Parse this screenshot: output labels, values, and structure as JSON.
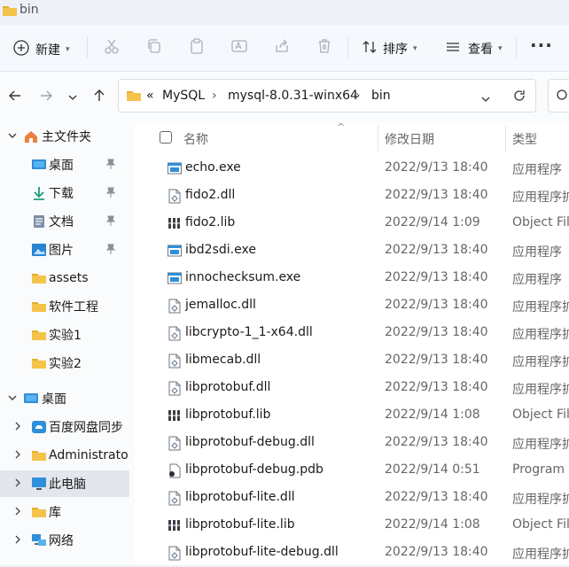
{
  "window": {
    "title": "bin"
  },
  "toolbar": {
    "new_label": "新建",
    "sort_label": "排序",
    "view_label": "查看",
    "more_label": "···"
  },
  "nav": {
    "breadcrumb_prefix": "«",
    "path": [
      "MySQL",
      "mysql-8.0.31-winx64",
      "bin"
    ],
    "separator": "›"
  },
  "sidebar": {
    "items": [
      {
        "label": "主文件夹",
        "icon": "home-icon",
        "expand": "open",
        "pinned": false,
        "selected": false
      },
      {
        "label": "桌面",
        "icon": "desktop-icon",
        "expand": "",
        "pinned": true,
        "selected": false
      },
      {
        "label": "下载",
        "icon": "download-icon",
        "expand": "",
        "pinned": true,
        "selected": false
      },
      {
        "label": "文档",
        "icon": "document-icon",
        "expand": "",
        "pinned": true,
        "selected": false
      },
      {
        "label": "图片",
        "icon": "pictures-icon",
        "expand": "",
        "pinned": true,
        "selected": false
      },
      {
        "label": "assets",
        "icon": "folder-icon",
        "expand": "",
        "pinned": false,
        "selected": false
      },
      {
        "label": "软件工程",
        "icon": "folder-icon",
        "expand": "",
        "pinned": false,
        "selected": false
      },
      {
        "label": "实验1",
        "icon": "folder-icon",
        "expand": "",
        "pinned": false,
        "selected": false
      },
      {
        "label": "实验2",
        "icon": "folder-icon",
        "expand": "",
        "pinned": false,
        "selected": false
      },
      {
        "label": "桌面",
        "icon": "desktop-icon",
        "expand": "open",
        "pinned": false,
        "selected": false
      },
      {
        "label": "百度网盘同步",
        "icon": "cloud-icon",
        "expand": "closed",
        "pinned": false,
        "selected": false
      },
      {
        "label": "Administrato",
        "icon": "folder-icon",
        "expand": "closed",
        "pinned": false,
        "selected": false
      },
      {
        "label": "此电脑",
        "icon": "computer-icon",
        "expand": "closed",
        "pinned": false,
        "selected": true
      },
      {
        "label": "库",
        "icon": "folder-icon",
        "expand": "closed",
        "pinned": false,
        "selected": false
      },
      {
        "label": "网络",
        "icon": "network-icon",
        "expand": "closed",
        "pinned": false,
        "selected": false
      }
    ]
  },
  "columns": {
    "name": "名称",
    "date": "修改日期",
    "type": "类型"
  },
  "files": [
    {
      "name": "echo.exe",
      "date": "2022/9/13 18:40",
      "type": "应用程序",
      "icon": "exe-icon"
    },
    {
      "name": "fido2.dll",
      "date": "2022/9/13 18:40",
      "type": "应用程序扩",
      "icon": "dll-icon"
    },
    {
      "name": "fido2.lib",
      "date": "2022/9/14 1:09",
      "type": "Object File",
      "icon": "lib-icon"
    },
    {
      "name": "ibd2sdi.exe",
      "date": "2022/9/13 18:40",
      "type": "应用程序",
      "icon": "exe-icon"
    },
    {
      "name": "innochecksum.exe",
      "date": "2022/9/13 18:40",
      "type": "应用程序",
      "icon": "exe-icon"
    },
    {
      "name": "jemalloc.dll",
      "date": "2022/9/13 18:40",
      "type": "应用程序扩",
      "icon": "dll-icon"
    },
    {
      "name": "libcrypto-1_1-x64.dll",
      "date": "2022/9/13 18:40",
      "type": "应用程序扩",
      "icon": "dll-icon"
    },
    {
      "name": "libmecab.dll",
      "date": "2022/9/13 18:40",
      "type": "应用程序扩",
      "icon": "dll-icon"
    },
    {
      "name": "libprotobuf.dll",
      "date": "2022/9/13 18:40",
      "type": "应用程序扩",
      "icon": "dll-icon"
    },
    {
      "name": "libprotobuf.lib",
      "date": "2022/9/14 1:08",
      "type": "Object File",
      "icon": "lib-icon"
    },
    {
      "name": "libprotobuf-debug.dll",
      "date": "2022/9/13 18:40",
      "type": "应用程序扩",
      "icon": "dll-icon"
    },
    {
      "name": "libprotobuf-debug.pdb",
      "date": "2022/9/14 0:51",
      "type": "Program D",
      "icon": "pdb-icon"
    },
    {
      "name": "libprotobuf-lite.dll",
      "date": "2022/9/13 18:40",
      "type": "应用程序扩",
      "icon": "dll-icon"
    },
    {
      "name": "libprotobuf-lite.lib",
      "date": "2022/9/14 1:08",
      "type": "Object File",
      "icon": "lib-icon"
    },
    {
      "name": "libprotobuf-lite-debug.dll",
      "date": "2022/9/13 18:40",
      "type": "应用程序扩",
      "icon": "dll-icon"
    }
  ]
}
